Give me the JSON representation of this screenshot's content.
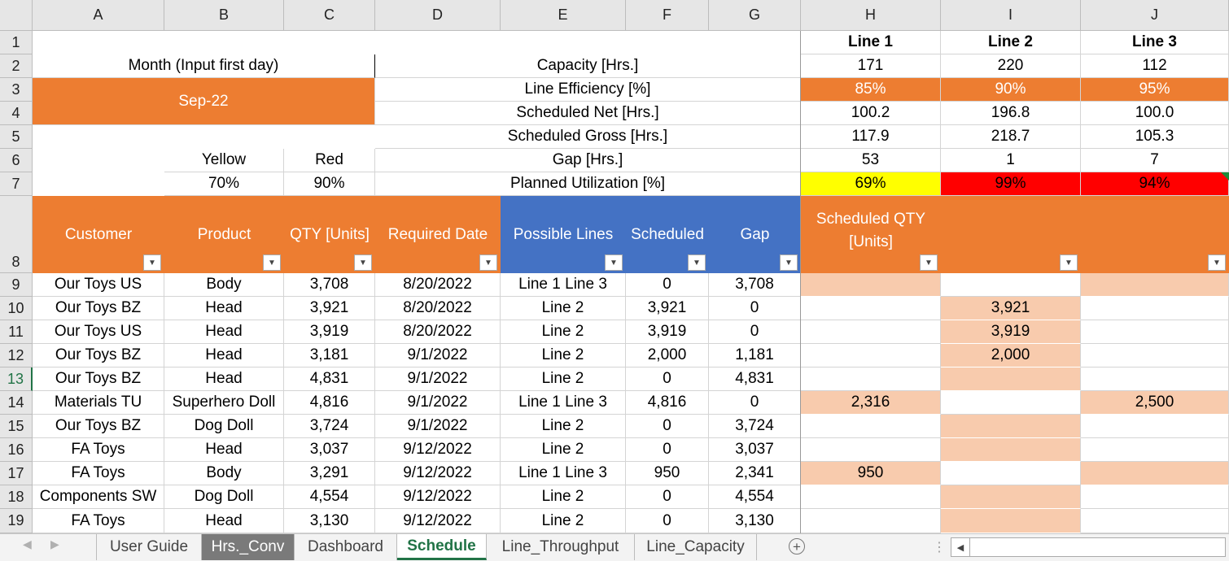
{
  "columns": [
    "A",
    "B",
    "C",
    "D",
    "E",
    "F",
    "G",
    "H",
    "I",
    "J"
  ],
  "rows": [
    "1",
    "2",
    "3",
    "4",
    "5",
    "6",
    "7",
    "8",
    "9",
    "10",
    "11",
    "12",
    "13",
    "14",
    "15",
    "16",
    "17",
    "18",
    "19"
  ],
  "selected_row": "13",
  "lines": {
    "line1": "Line 1",
    "line2": "Line 2",
    "line3": "Line 3"
  },
  "input": {
    "month_label": "Month (Input first day)",
    "month_value": "Sep-22",
    "yellow_label": "Yellow",
    "red_label": "Red",
    "yellow_value": "70%",
    "red_value": "90%"
  },
  "metrics": [
    {
      "label": "Capacity [Hrs.]",
      "values": [
        "171",
        "220",
        "112"
      ]
    },
    {
      "label": "Line Efficiency [%]",
      "values": [
        "85%",
        "90%",
        "95%"
      ]
    },
    {
      "label": "Scheduled Net [Hrs.]",
      "values": [
        "100.2",
        "196.8",
        "100.0"
      ]
    },
    {
      "label": "Scheduled Gross [Hrs.]",
      "values": [
        "117.9",
        "218.7",
        "105.3"
      ]
    },
    {
      "label": "Gap [Hrs.]",
      "values": [
        "53",
        "1",
        "7"
      ]
    },
    {
      "label": "Planned Utilization [%]",
      "values": [
        "69%",
        "99%",
        "94%"
      ]
    }
  ],
  "table_headers": {
    "customer": "Customer",
    "product": "Product",
    "qty": "QTY [Units]",
    "date": "Required Date",
    "lines": "Possible Lines",
    "scheduled": "Scheduled",
    "gap": "Gap",
    "sched_qty_1": "Scheduled QTY",
    "sched_qty_2": "[Units]"
  },
  "orders": [
    {
      "customer": "Our Toys US",
      "product": "Body",
      "qty": "3,708",
      "date": "8/20/2022",
      "lines": "Line 1 Line 3",
      "scheduled": "0",
      "gap": "3,708",
      "l1": "",
      "l2": "",
      "l3": ""
    },
    {
      "customer": "Our Toys BZ",
      "product": "Head",
      "qty": "3,921",
      "date": "8/20/2022",
      "lines": "Line 2",
      "scheduled": "3,921",
      "gap": "0",
      "l1": "",
      "l2": "3,921",
      "l3": ""
    },
    {
      "customer": "Our Toys US",
      "product": "Head",
      "qty": "3,919",
      "date": "8/20/2022",
      "lines": "Line 2",
      "scheduled": "3,919",
      "gap": "0",
      "l1": "",
      "l2": "3,919",
      "l3": ""
    },
    {
      "customer": "Our Toys BZ",
      "product": "Head",
      "qty": "3,181",
      "date": "9/1/2022",
      "lines": "Line 2",
      "scheduled": "2,000",
      "gap": "1,181",
      "l1": "",
      "l2": "2,000",
      "l3": ""
    },
    {
      "customer": "Our Toys BZ",
      "product": "Head",
      "qty": "4,831",
      "date": "9/1/2022",
      "lines": "Line 2",
      "scheduled": "0",
      "gap": "4,831",
      "l1": "",
      "l2": "",
      "l3": ""
    },
    {
      "customer": "Materials TU",
      "product": "Superhero Doll",
      "qty": "4,816",
      "date": "9/1/2022",
      "lines": "Line 1 Line 3",
      "scheduled": "4,816",
      "gap": "0",
      "l1": "2,316",
      "l2": "",
      "l3": "2,500"
    },
    {
      "customer": "Our Toys BZ",
      "product": "Dog Doll",
      "qty": "3,724",
      "date": "9/1/2022",
      "lines": "Line 2",
      "scheduled": "0",
      "gap": "3,724",
      "l1": "",
      "l2": "",
      "l3": ""
    },
    {
      "customer": "FA Toys",
      "product": "Head",
      "qty": "3,037",
      "date": "9/12/2022",
      "lines": "Line 2",
      "scheduled": "0",
      "gap": "3,037",
      "l1": "",
      "l2": "",
      "l3": ""
    },
    {
      "customer": "FA Toys",
      "product": "Body",
      "qty": "3,291",
      "date": "9/12/2022",
      "lines": "Line 1 Line 3",
      "scheduled": "950",
      "gap": "2,341",
      "l1": "950",
      "l2": "",
      "l3": ""
    },
    {
      "customer": "Components SW",
      "product": "Dog Doll",
      "qty": "4,554",
      "date": "9/12/2022",
      "lines": "Line 2",
      "scheduled": "0",
      "gap": "4,554",
      "l1": "",
      "l2": "",
      "l3": ""
    },
    {
      "customer": "FA Toys",
      "product": "Head",
      "qty": "3,130",
      "date": "9/12/2022",
      "lines": "Line 2",
      "scheduled": "0",
      "gap": "3,130",
      "l1": "",
      "l2": "",
      "l3": ""
    }
  ],
  "tabs": [
    {
      "label": "User Guide",
      "state": "normal"
    },
    {
      "label": "Hrs._Conv",
      "state": "gray"
    },
    {
      "label": "Dashboard",
      "state": "normal"
    },
    {
      "label": "Schedule",
      "state": "active"
    },
    {
      "label": "Line_Throughput",
      "state": "normal"
    },
    {
      "label": "Line_Capacity",
      "state": "normal"
    }
  ],
  "icons": {
    "prev": "scroll-left-icon",
    "next": "scroll-right-icon",
    "add": "add-sheet-icon",
    "filter": "filter-dropdown-icon"
  },
  "colors": {
    "orange": "#ED7D31",
    "blue": "#4472C4",
    "peach": "#F8CBAD",
    "yellow": "#FFFF00",
    "red": "#FF0000",
    "excel_green": "#217346"
  }
}
